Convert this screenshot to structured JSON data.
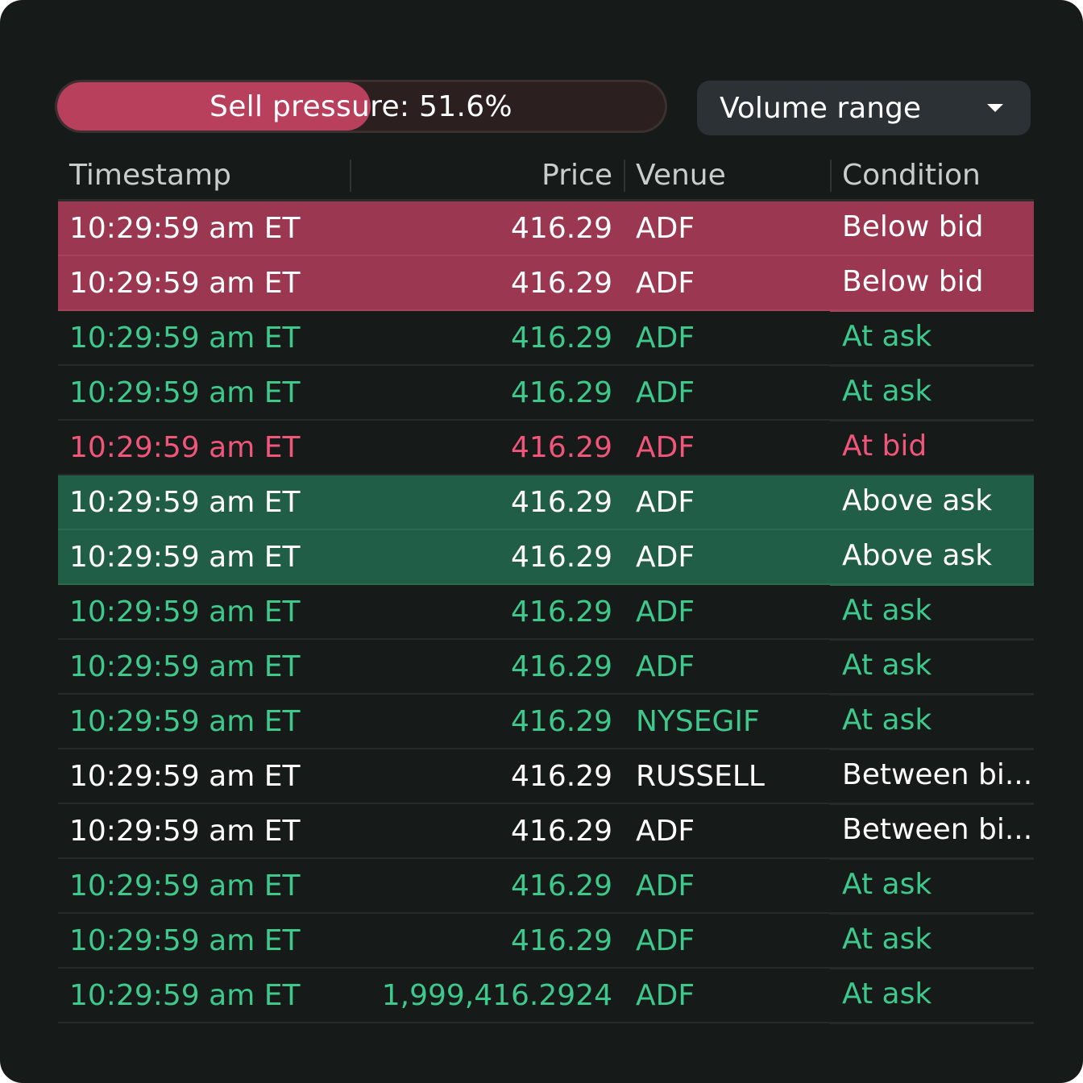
{
  "pressure": {
    "label": "Sell pressure: 51.6%",
    "fraction": 0.516,
    "fill_color": "#b8405c"
  },
  "dropdown": {
    "label": "Volume range",
    "icon": "caret-down-icon"
  },
  "table": {
    "headers": {
      "timestamp": "Timestamp",
      "price": "Price",
      "venue": "Venue",
      "condition": "Condition"
    },
    "rows": [
      {
        "timestamp": "10:29:59 am ET",
        "price": "416.29",
        "venue": "ADF",
        "condition": "Below bid",
        "text": "white",
        "highlight": "red"
      },
      {
        "timestamp": "10:29:59 am ET",
        "price": "416.29",
        "venue": "ADF",
        "condition": "Below bid",
        "text": "white",
        "highlight": "red"
      },
      {
        "timestamp": "10:29:59 am ET",
        "price": "416.29",
        "venue": "ADF",
        "condition": "At ask",
        "text": "green",
        "highlight": "none"
      },
      {
        "timestamp": "10:29:59 am ET",
        "price": "416.29",
        "venue": "ADF",
        "condition": "At ask",
        "text": "green",
        "highlight": "none"
      },
      {
        "timestamp": "10:29:59 am ET",
        "price": "416.29",
        "venue": "ADF",
        "condition": "At bid",
        "text": "red",
        "highlight": "none"
      },
      {
        "timestamp": "10:29:59 am ET",
        "price": "416.29",
        "venue": "ADF",
        "condition": "Above ask",
        "text": "white",
        "highlight": "green"
      },
      {
        "timestamp": "10:29:59 am ET",
        "price": "416.29",
        "venue": "ADF",
        "condition": "Above ask",
        "text": "white",
        "highlight": "green"
      },
      {
        "timestamp": "10:29:59 am ET",
        "price": "416.29",
        "venue": "ADF",
        "condition": "At ask",
        "text": "green",
        "highlight": "none"
      },
      {
        "timestamp": "10:29:59 am ET",
        "price": "416.29",
        "venue": "ADF",
        "condition": "At ask",
        "text": "green",
        "highlight": "none"
      },
      {
        "timestamp": "10:29:59 am ET",
        "price": "416.29",
        "venue": "NYSEGIF",
        "condition": "At ask",
        "text": "green",
        "highlight": "none"
      },
      {
        "timestamp": "10:29:59 am ET",
        "price": "416.29",
        "venue": "RUSSELL",
        "condition": "Between bi...",
        "text": "white",
        "highlight": "none"
      },
      {
        "timestamp": "10:29:59 am ET",
        "price": "416.29",
        "venue": "ADF",
        "condition": "Between bi...",
        "text": "white",
        "highlight": "none"
      },
      {
        "timestamp": "10:29:59 am ET",
        "price": "416.29",
        "venue": "ADF",
        "condition": "At ask",
        "text": "green",
        "highlight": "none"
      },
      {
        "timestamp": "10:29:59 am ET",
        "price": "416.29",
        "venue": "ADF",
        "condition": "At ask",
        "text": "green",
        "highlight": "none"
      },
      {
        "timestamp": "10:29:59 am ET",
        "price": "1,999,416.2924",
        "venue": "ADF",
        "condition": "At ask",
        "text": "green",
        "highlight": "none"
      }
    ]
  },
  "colors": {
    "background": "#161a18",
    "green_text": "#3ec98c",
    "red_text": "#f0557a",
    "red_highlight": "#9b3750",
    "green_highlight": "#205e47"
  }
}
